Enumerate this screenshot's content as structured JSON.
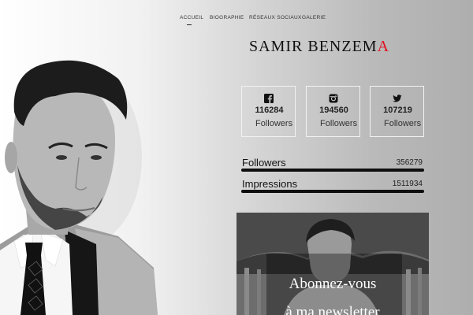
{
  "nav": {
    "items": [
      "ACCUEIL",
      "BIOGRAPHIE",
      "RÉSEAUX SOCIAUX",
      "GALERIE"
    ]
  },
  "header": {
    "title_main": "SAMIR BENZEM",
    "title_accent": "A",
    "accent_color": "#e0101c"
  },
  "social": [
    {
      "network": "facebook-icon",
      "count": "116284",
      "label": "Followers"
    },
    {
      "network": "instagram-icon",
      "count": "194560",
      "label": "Followers"
    },
    {
      "network": "twitter-icon",
      "count": "107219",
      "label": "Followers"
    }
  ],
  "stats": [
    {
      "label": "Followers",
      "value": "356279",
      "fill_fraction": 1.0
    },
    {
      "label": "Impressions",
      "value": "1511934",
      "fill_fraction": 1.0
    }
  ],
  "newsletter": {
    "line1": "Abonnez-vous",
    "line2": "à ma newsletter"
  }
}
